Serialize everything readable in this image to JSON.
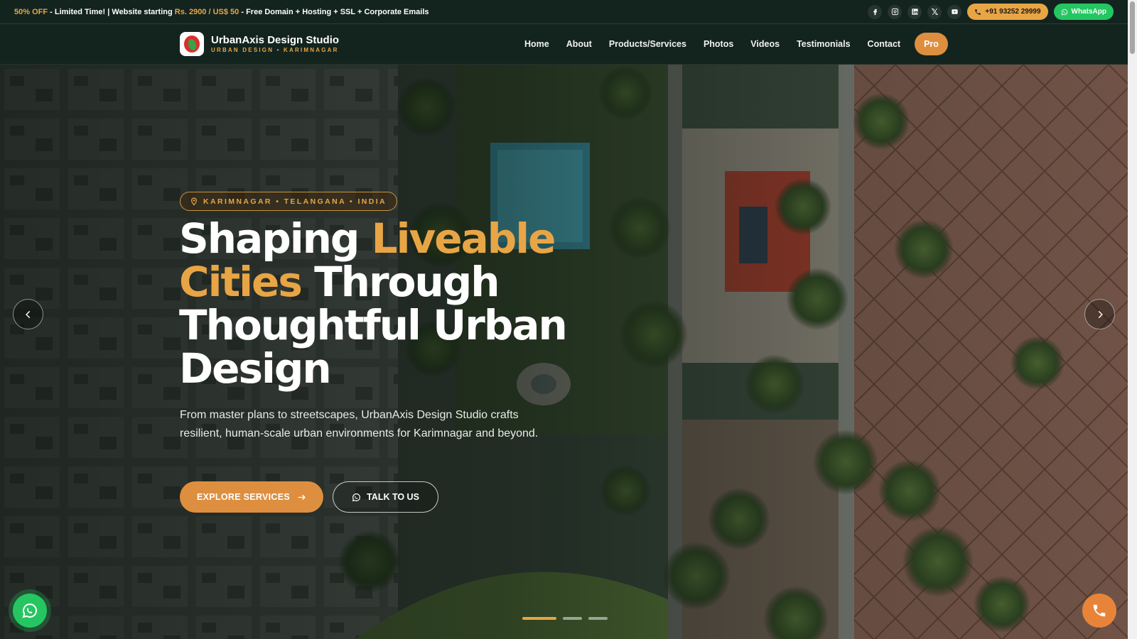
{
  "topbar": {
    "promo_a": "50% OFF",
    "promo_b": " - Limited Time! | Website starting ",
    "promo_c": "Rs. 2900 / US$ 50",
    "promo_d": " - Free Domain + Hosting + SSL + Corporate Emails",
    "social_icons": [
      "facebook-icon",
      "instagram-icon",
      "linkedin-icon",
      "x-icon",
      "youtube-icon"
    ],
    "x_glyph": "𝕏",
    "phone_label": "+91 93252 29999",
    "whatsapp_label": "WhatsApp"
  },
  "header": {
    "brand_name": "UrbanAxis Design Studio",
    "brand_tagline": "URBAN DESIGN • KARIMNAGAR",
    "nav": [
      "Home",
      "About",
      "Products/Services",
      "Photos",
      "Videos",
      "Testimonials",
      "Contact"
    ],
    "cta": "Pro"
  },
  "hero": {
    "location_badge": "KARIMNAGAR • TELANGANA • INDIA",
    "headline_1": "Shaping ",
    "headline_hl_1": "Liveable Cities",
    "headline_2": " Through Thoughtful Urban Design",
    "lede": "From master plans to streetscapes, UrbanAxis Design Studio crafts resilient, human-scale urban environments for Karimnagar and beyond.",
    "primary_button": "EXPLORE SERVICES",
    "secondary_button": "TALK TO US",
    "slides_total": 3,
    "slide_active": 1
  },
  "colors": {
    "accent": "#e8a545",
    "cta_orange": "#dd8f3f",
    "whatsapp_green": "#25c661",
    "bar_bg": "#13241f"
  }
}
